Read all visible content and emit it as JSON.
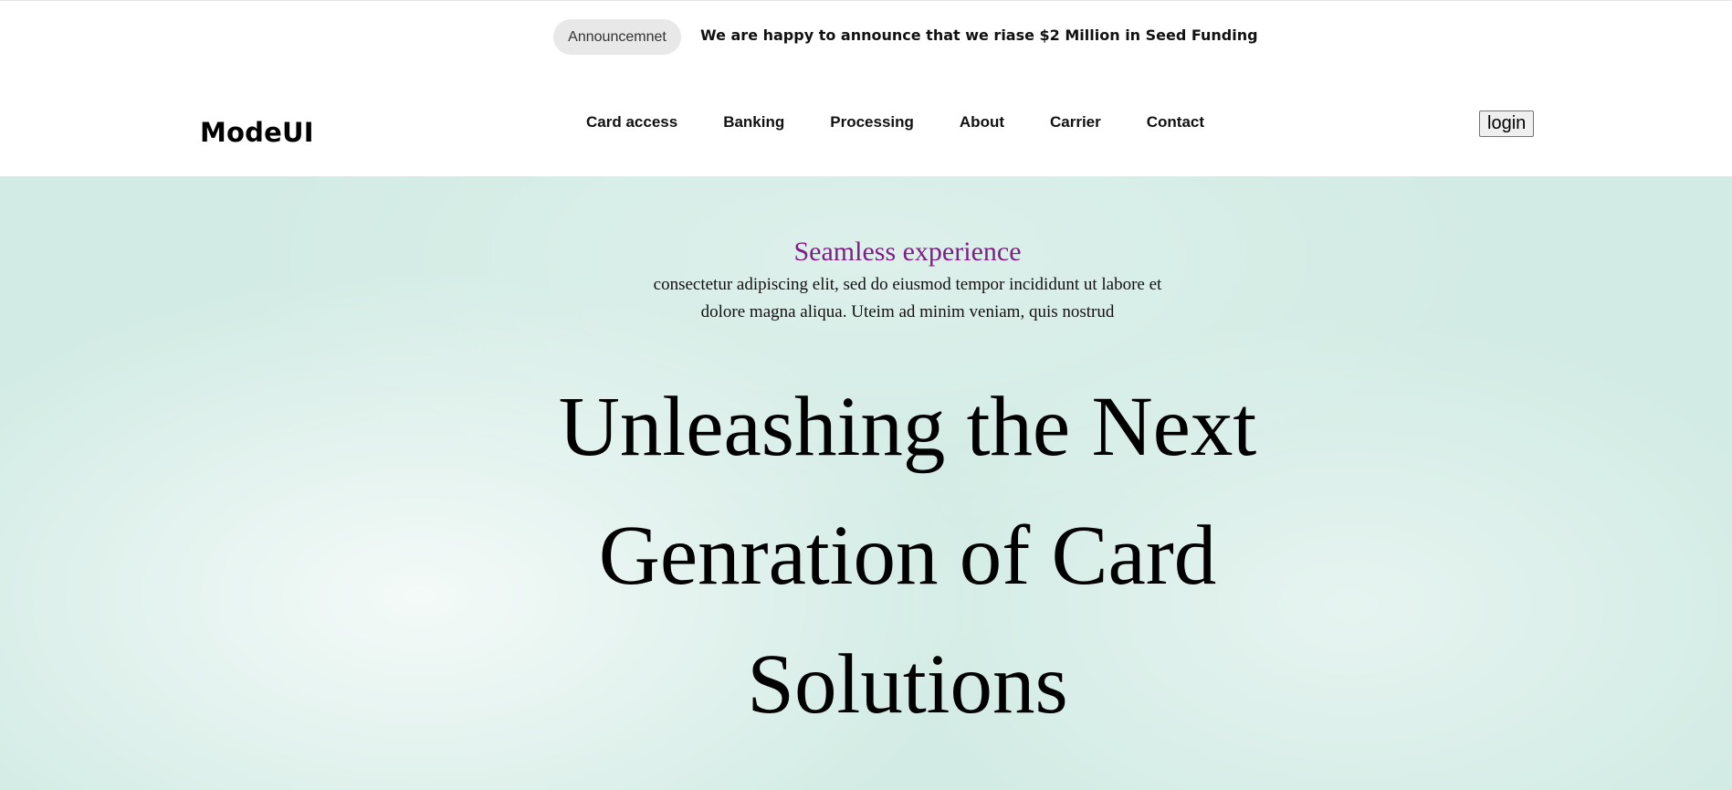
{
  "announcement": {
    "badge": "Announcemnet",
    "message": "We are happy to announce that we riase $2 Million in Seed Funding"
  },
  "header": {
    "logo": "ModeUI",
    "nav": [
      {
        "label": "Card access"
      },
      {
        "label": "Banking"
      },
      {
        "label": "Processing"
      },
      {
        "label": "About"
      },
      {
        "label": "Carrier"
      },
      {
        "label": "Contact"
      }
    ],
    "login_label": "login"
  },
  "hero": {
    "eyebrow": "Seamless experience",
    "description": "consectetur adipiscing elit, sed do eiusmod tempor incididunt ut labore et dolore magna aliqua. Uteim ad minim veniam, quis nostrud",
    "title": "Unleashing the Next Genration of Card Solutions"
  },
  "colors": {
    "hero_background": "#d2ebe4",
    "eyebrow": "#7e1f86",
    "badge_background": "#e8e8e8"
  }
}
